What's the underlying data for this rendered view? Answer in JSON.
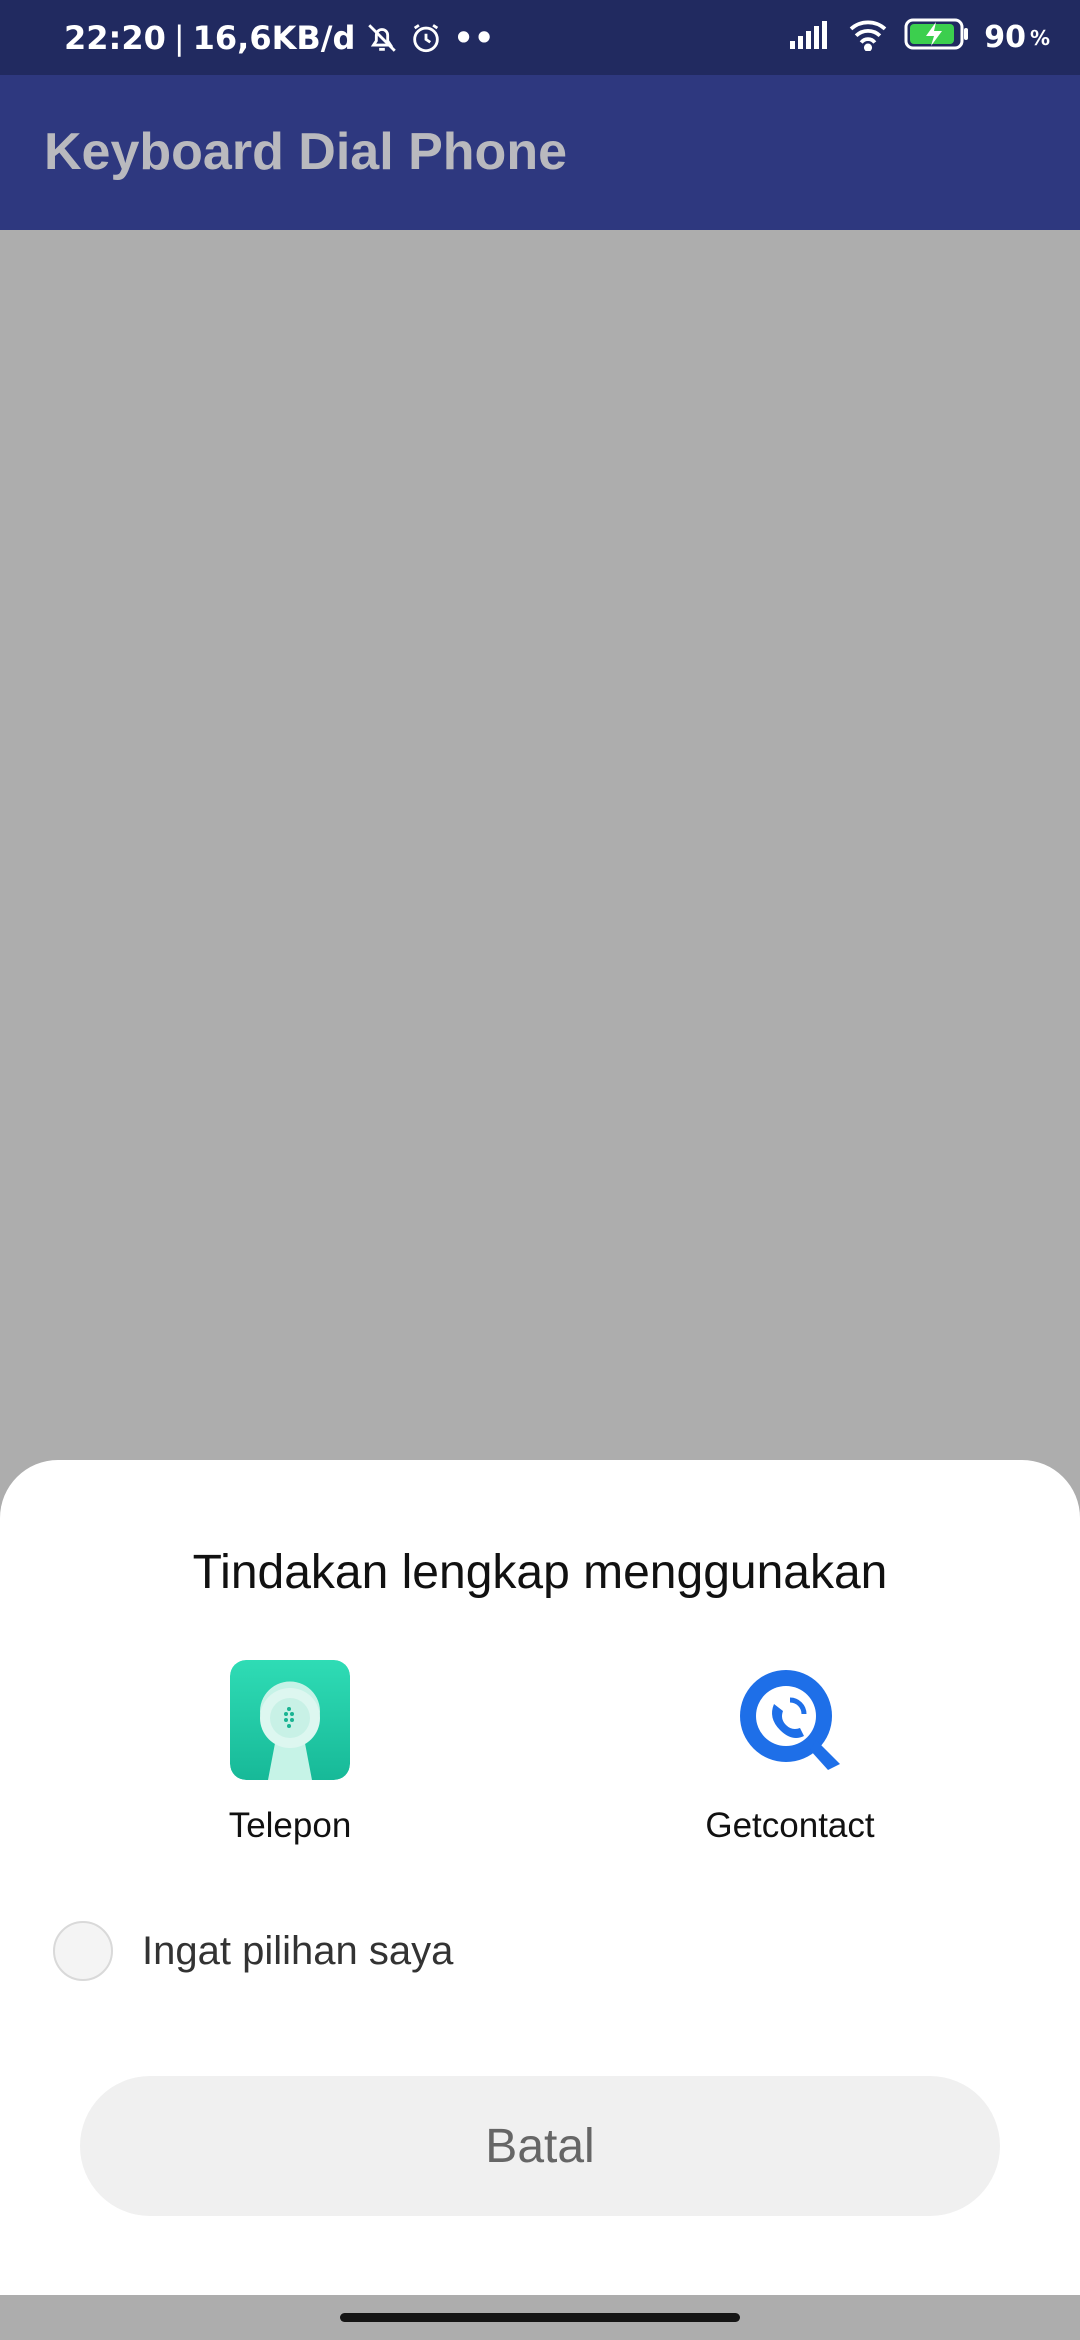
{
  "status_bar": {
    "time": "22:20",
    "separator": "|",
    "network_speed": "16,6KB/d",
    "dots": "••",
    "battery_level": "90",
    "battery_unit": "%",
    "icons": [
      "notifications-off-icon",
      "alarm-icon",
      "signal-icon",
      "wifi-icon",
      "battery-charging-icon"
    ]
  },
  "app_bar": {
    "title": "Keyboard Dial Phone"
  },
  "sheet": {
    "title": "Tindakan lengkap menggunakan",
    "apps": [
      {
        "label": "Telepon",
        "icon": "telepon-app-icon",
        "color": "#21c9a6"
      },
      {
        "label": "Getcontact",
        "icon": "getcontact-app-icon",
        "color": "#1e6fe8"
      }
    ],
    "remember_label": "Ingat pilihan saya",
    "remember_checked": false,
    "cancel_label": "Batal"
  },
  "colors": {
    "status_bar": "#212a60",
    "app_bar": "#2e387f",
    "scrim": "#adadad",
    "sheet": "#ffffff"
  }
}
